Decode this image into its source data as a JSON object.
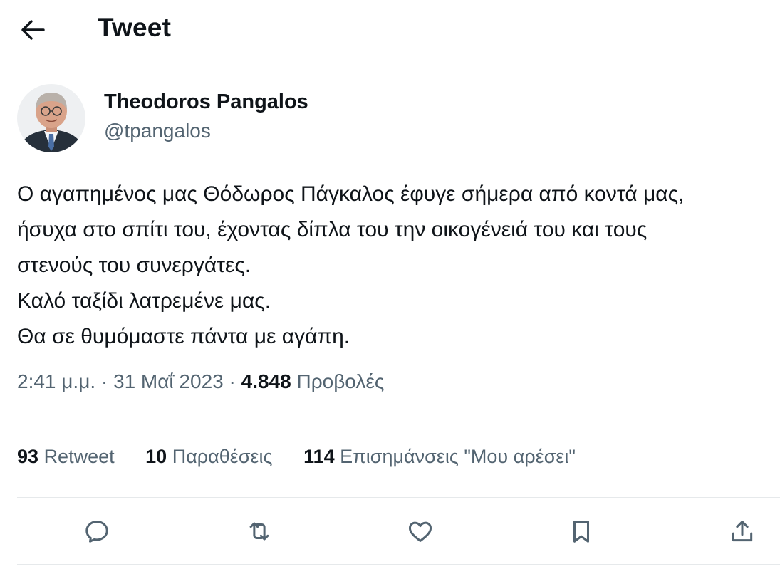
{
  "header": {
    "title": "Tweet",
    "back_icon": "arrow-left-icon"
  },
  "author": {
    "display_name": "Theodoros Pangalos",
    "handle": "@tpangalos"
  },
  "tweet": {
    "text": "Ο αγαπημένος μας Θόδωρος Πάγκαλος έφυγε σήμερα από κοντά μας,\nήσυχα στο σπίτι του, έχοντας δίπλα του την οικογένειά του και τους\nστενούς του συνεργάτες.\nΚαλό ταξίδι λατρεμένε μας.\nΘα σε θυμόμαστε πάντα με αγάπη.",
    "time": "2:41 μ.μ.",
    "separator": "·",
    "date": "31 Μαΐ 2023",
    "views_count": "4.848",
    "views_label": "Προβολές"
  },
  "stats": [
    {
      "count": "93",
      "label": "Retweet"
    },
    {
      "count": "10",
      "label": "Παραθέσεις"
    },
    {
      "count": "114",
      "label": "Επισημάνσεις \"Μου αρέσει\""
    }
  ],
  "actions": {
    "reply_icon": "reply-icon",
    "retweet_icon": "retweet-icon",
    "like_icon": "heart-icon",
    "bookmark_icon": "bookmark-icon",
    "share_icon": "share-icon"
  },
  "colors": {
    "text": "#0f1419",
    "secondary": "#536471",
    "divider": "#e6e9eb"
  }
}
